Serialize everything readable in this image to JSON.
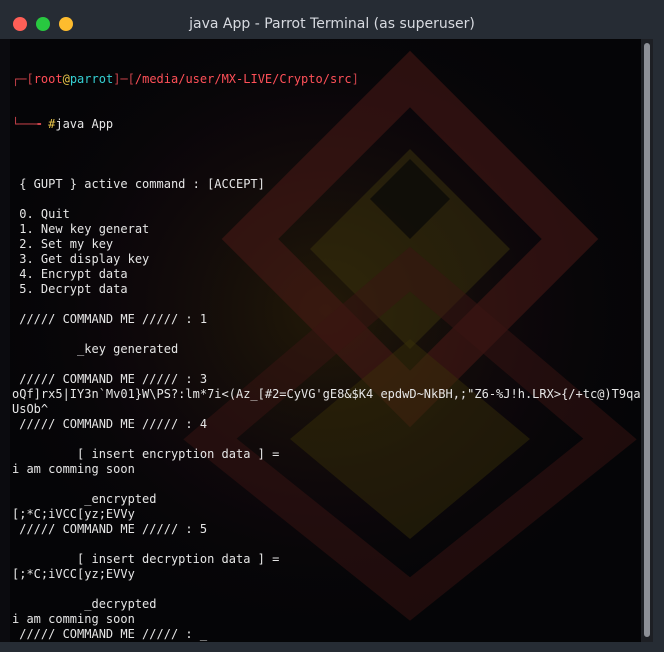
{
  "window": {
    "title": "java App - Parrot Terminal (as superuser)"
  },
  "colors": {
    "prompt_bracket": "#c9424a",
    "prompt_user": "#ff4d57",
    "prompt_host": "#35d0d3",
    "prompt_path": "#ff5058",
    "prompt_hash": "#e8c54b",
    "text": "#e6e6e6"
  },
  "prompt": {
    "open": "┌─[",
    "user": "root",
    "at": "@",
    "host": "parrot",
    "middle": "]─[",
    "path": "/media/user/MX-LIVE/Crypto/src",
    "close": "]",
    "second_line_prefix": "└──╼ ",
    "hash": "#",
    "command": "java App"
  },
  "output": [
    "",
    " { GUPT } active command : [ACCEPT]",
    "",
    " 0. Quit",
    " 1. New key generat",
    " 2. Set my key",
    " 3. Get display key",
    " 4. Encrypt data",
    " 5. Decrypt data",
    "",
    " ///// COMMAND ME ///// : 1",
    "",
    "         _key generated",
    "",
    " ///// COMMAND ME ///// : 3",
    "oQf]rx5|IY3n`Mv01}W\\PS?:lm*7i<(Az_[#2=CyVG'gE8&$K4 epdwD~NkBH,;\"Z6-%J!h.LRX>{/+tc@)T9qajuF",
    "UsOb^",
    " ///// COMMAND ME ///// : 4",
    "",
    "         [ insert encryption data ] =",
    "i am comming soon",
    "",
    "          _encrypted",
    "[;*C;iVCC[yz;EVVy",
    " ///// COMMAND ME ///// : 5",
    "",
    "         [ insert decryption data ] =",
    "[;*C;iVCC[yz;EVVy",
    "",
    "          _decrypted",
    "i am comming soon",
    " ///// COMMAND ME ///// : _"
  ]
}
